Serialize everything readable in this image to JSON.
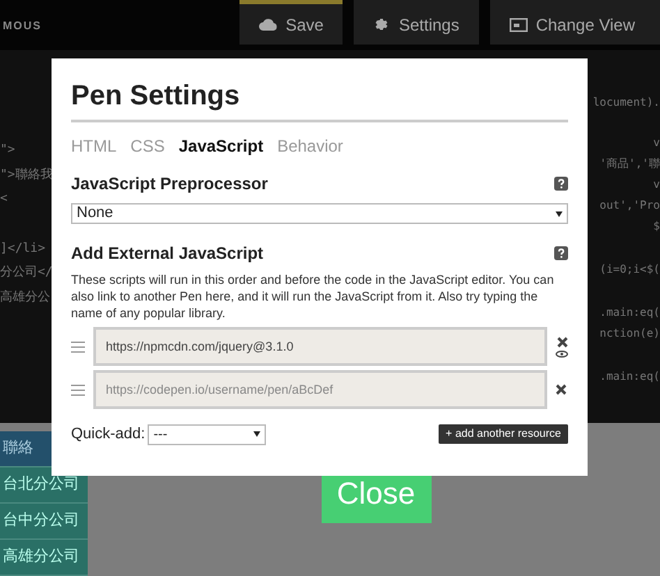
{
  "header": {
    "brand": "MOUS",
    "buttons": [
      {
        "kind": "save",
        "label": "Save",
        "highlighted": true
      },
      {
        "kind": "settings",
        "label": "Settings",
        "highlighted": false
      },
      {
        "kind": "view",
        "label": "Change View",
        "highlighted": false
      }
    ]
  },
  "editor": {
    "left_lines": [
      "\">",
      "\">聯絡我",
      "<",
      "]</li>",
      "分公司</",
      "高雄分公"
    ],
    "right_lines": [
      "locument).",
      "v",
      "'商品','聯",
      "v",
      "out','Pro",
      "$",
      "(i=0;i<$(",
      ".main:eq(",
      "nction(e)",
      ".main:eq("
    ]
  },
  "preview": {
    "nav_items": [
      {
        "label": "聯絡",
        "selected": true
      },
      {
        "label": "台北分公司",
        "selected": false
      },
      {
        "label": "台中分公司",
        "selected": false
      },
      {
        "label": "高雄分公司",
        "selected": false
      }
    ]
  },
  "dialog": {
    "title": "Pen Settings",
    "tabs": [
      {
        "label": "HTML",
        "selected": false
      },
      {
        "label": "CSS",
        "selected": false
      },
      {
        "label": "JavaScript",
        "selected": true
      },
      {
        "label": "Behavior",
        "selected": false
      }
    ],
    "preprocessor": {
      "heading": "JavaScript Preprocessor",
      "value": "None"
    },
    "external": {
      "heading": "Add External JavaScript",
      "description": "These scripts will run in this order and before the code in the JavaScript editor. You can also link to another Pen here, and it will run the JavaScript from it. Also try typing the name of any popular library.",
      "resources": [
        {
          "value": "https://npmcdn.com/jquery@3.1.0",
          "previewable": true
        },
        {
          "placeholder": "https://codepen.io/username/pen/aBcDef",
          "previewable": false
        }
      ],
      "quick_add_label": "Quick-add:",
      "quick_add_value": "---",
      "add_button": "+ add another resource"
    }
  },
  "close_button": "Close"
}
